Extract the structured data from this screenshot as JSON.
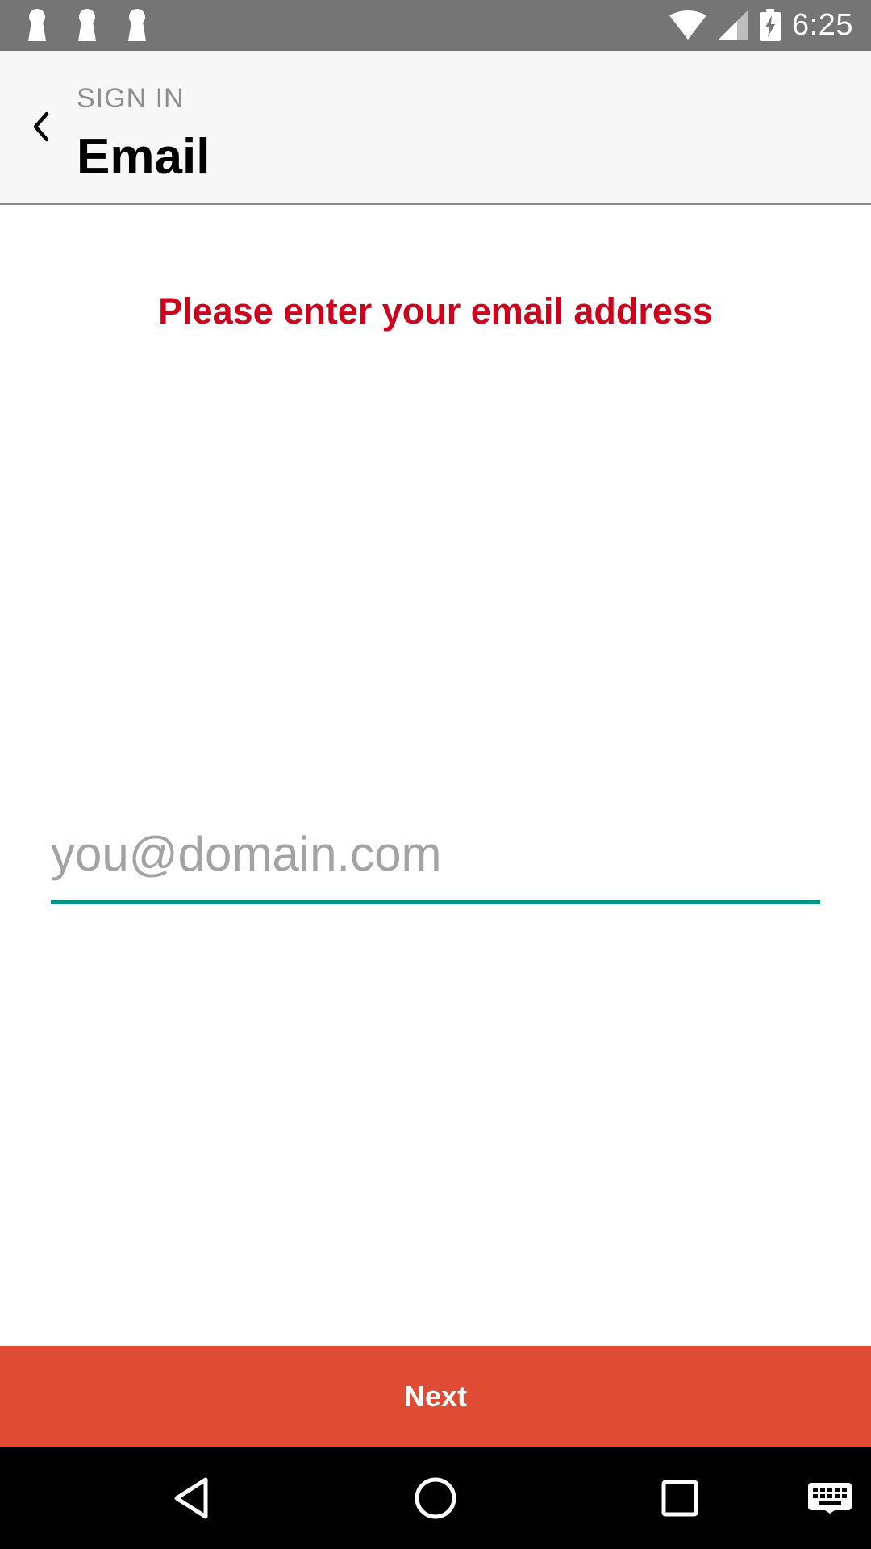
{
  "status_bar": {
    "time": "6:25",
    "notification_icons": [
      "keyhole-icon",
      "keyhole-icon",
      "keyhole-icon"
    ],
    "system_icons": [
      "wifi-icon",
      "cell-signal-icon",
      "battery-charging-icon"
    ]
  },
  "app_bar": {
    "overline": "SIGN IN",
    "title": "Email",
    "back_icon": "chevron-left-icon"
  },
  "prompt": "Please enter your email address",
  "email_input": {
    "placeholder": "you@domain.com",
    "value": "",
    "accent_color": "#00968a"
  },
  "next_button": {
    "label": "Next",
    "color": "#e04b34"
  },
  "nav_bar": {
    "buttons": [
      "back-triangle-icon",
      "home-circle-icon",
      "recents-square-icon",
      "keyboard-icon"
    ]
  },
  "colors": {
    "status_bar": "#757575",
    "app_bar": "#f7f7f7",
    "prompt": "#d0021b",
    "nav_bar": "#000000"
  }
}
